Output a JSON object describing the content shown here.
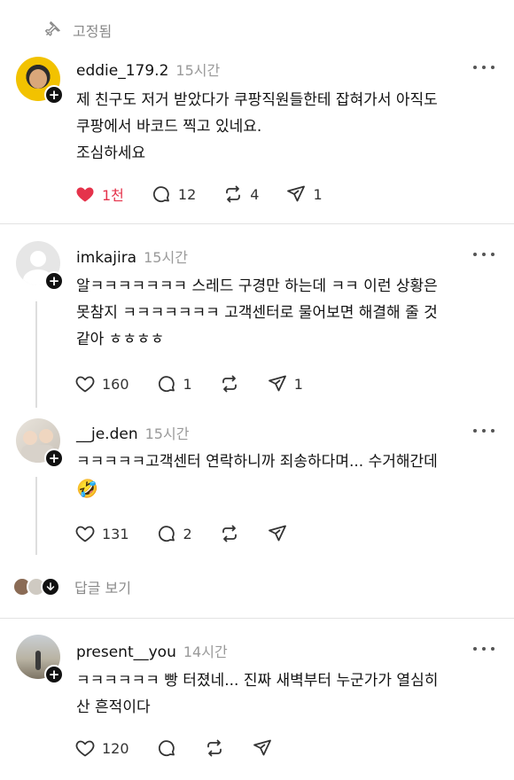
{
  "pinned_label": "고정됨",
  "posts": [
    {
      "username": "eddie_179.2",
      "time": "15시간",
      "text": "제 친구도 저거 받았다가 쿠팡직원들한테 잡혀가서 아직도\n쿠팡에서 바코드 찍고 있네요.\n조심하세요",
      "likes": "1천",
      "comments": "12",
      "reposts": "4",
      "shares": "1",
      "liked": true
    },
    {
      "username": "imkajira",
      "time": "15시간",
      "text": "알ㅋㅋㅋㅋㅋㅋㅋ 스레드 구경만 하는데 ㅋㅋ 이런 상황은\n못참지 ㅋㅋㅋㅋㅋㅋㅋ 고객센터로 물어보면 해결해 줄 것\n같아 ㅎㅎㅎㅎ",
      "likes": "160",
      "comments": "1",
      "reposts": "",
      "shares": "1"
    },
    {
      "username": "__je.den",
      "time": "15시간",
      "text": "ㅋㅋㅋㅋㅋ고객센터 연락하니까 죄송하다며... 수거해간데",
      "emoji": "🤣",
      "likes": "131",
      "comments": "2",
      "reposts": "",
      "shares": ""
    },
    {
      "username": "present__you",
      "time": "14시간",
      "text": "ㅋㅋㅋㅋㅋㅋ 빵 터졌네... 진짜 새벽부터 누군가가 열심히\n산 흔적이다",
      "likes": "120",
      "comments": "",
      "reposts": "",
      "shares": ""
    }
  ],
  "view_replies_label": "답글 보기",
  "colors": {
    "like_red": "#e5334b",
    "muted": "#8a8a8a",
    "divider": "#e3e3e3"
  }
}
